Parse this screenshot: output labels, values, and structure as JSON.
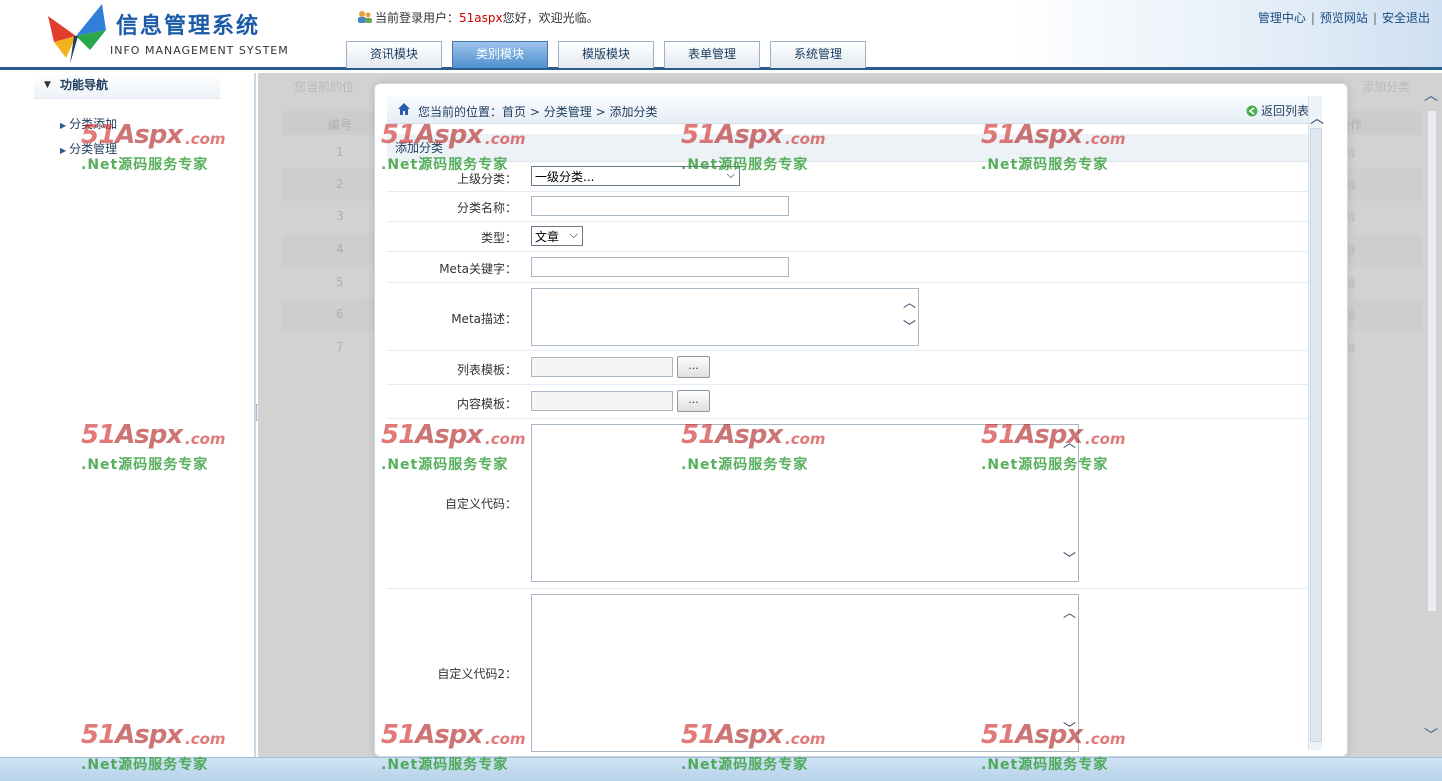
{
  "header": {
    "logo_title": "信息管理系统",
    "logo_subtitle": "INFO MANAGEMENT SYSTEM",
    "user_prefix": "当前登录用户：",
    "user_name": "51aspx",
    "user_suffix": "您好，欢迎光临。",
    "links": {
      "admin": "管理中心",
      "preview": "预览网站",
      "logout": "安全退出",
      "sep": "|"
    },
    "tabs": [
      {
        "label": "资讯模块",
        "active": false
      },
      {
        "label": "类别模块",
        "active": true
      },
      {
        "label": "模版模块",
        "active": false
      },
      {
        "label": "表单管理",
        "active": false
      },
      {
        "label": "系统管理",
        "active": false
      }
    ]
  },
  "sidebar": {
    "title": "功能导航",
    "items": [
      {
        "label": "分类添加"
      },
      {
        "label": "分类管理"
      }
    ],
    "collapse_label": "«"
  },
  "background_list": {
    "breadcrumb": "您当前的位",
    "add_label": "添加分类",
    "col_number": "编号",
    "col_action": "操作",
    "row_numbers": [
      "1",
      "2",
      "3",
      "4",
      "5",
      "6",
      "7"
    ],
    "row_action": "删除"
  },
  "dialog": {
    "breadcrumb_prefix": "您当前的位置：",
    "crumbs": [
      "首页",
      "分类管理",
      "添加分类"
    ],
    "crumb_sep": ">",
    "back_label": "返回列表",
    "section_title": "添加分类",
    "fields": {
      "parent_label": "上级分类：",
      "parent_value": "一级分类...",
      "name_label": "分类名称：",
      "name_value": "",
      "type_label": "类型：",
      "type_value": "文章",
      "keywords_label": "Meta关键字：",
      "keywords_value": "",
      "desc_label": "Meta描述：",
      "list_tpl_label": "列表模板：",
      "content_tpl_label": "内容模板：",
      "browse_label": "...",
      "custom1_label": "自定义代码：",
      "custom2_label": "自定义代码2："
    }
  },
  "watermark": {
    "brand_num": "51",
    "brand_name": "Aspx",
    "brand_tld": ".com",
    "slogan": ".Net源码服务专家"
  },
  "colors": {
    "accent": "#2b5c8f",
    "active_tab": "#4e8fcf",
    "username": "#cc0000",
    "watermark_red": "#cf2a2a",
    "watermark_green": "#3aa040"
  }
}
